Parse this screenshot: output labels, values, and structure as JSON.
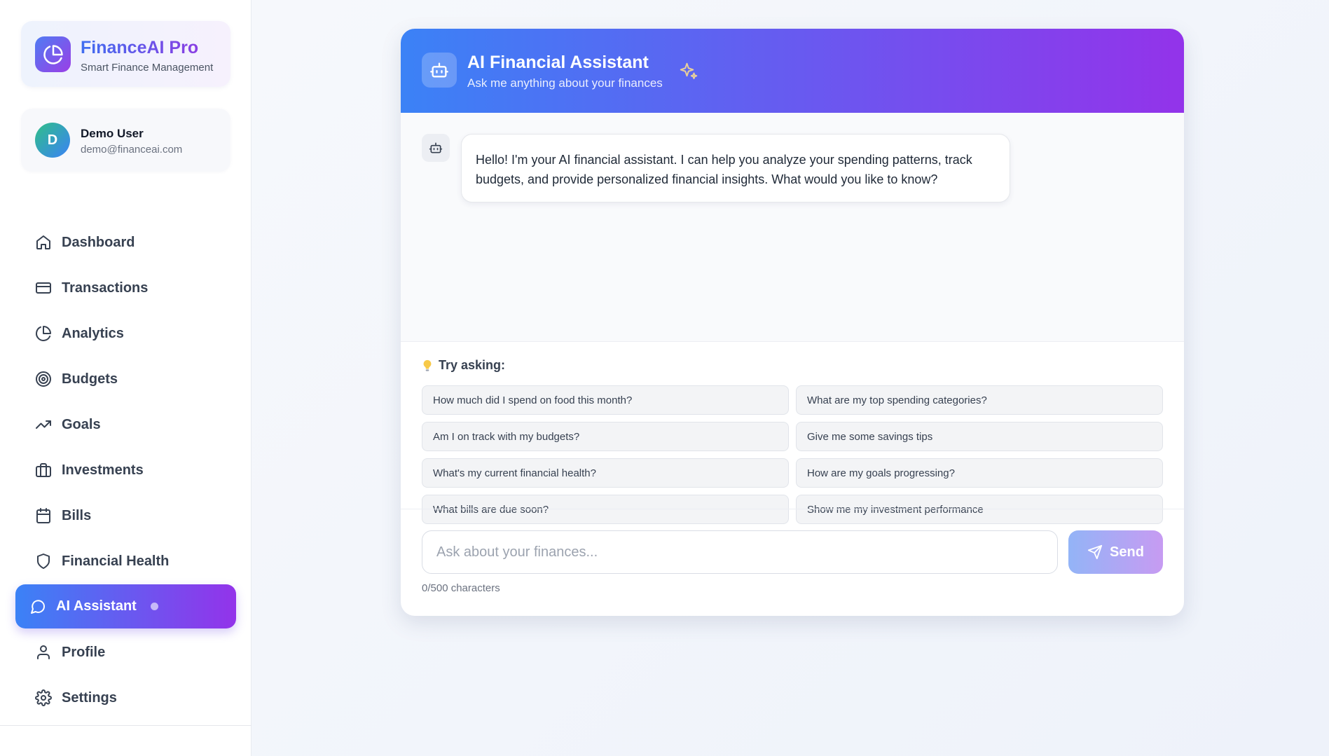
{
  "brand": {
    "name": "FinanceAI Pro",
    "subtitle": "Smart Finance Management"
  },
  "user": {
    "initial": "D",
    "name": "Demo User",
    "email": "demo@financeai.com"
  },
  "nav": {
    "items": [
      {
        "label": "Dashboard",
        "icon": "home-icon"
      },
      {
        "label": "Transactions",
        "icon": "credit-card-icon"
      },
      {
        "label": "Analytics",
        "icon": "pie-chart-icon"
      },
      {
        "label": "Budgets",
        "icon": "target-icon"
      },
      {
        "label": "Goals",
        "icon": "trending-up-icon"
      },
      {
        "label": "Investments",
        "icon": "briefcase-icon"
      },
      {
        "label": "Bills",
        "icon": "calendar-icon"
      },
      {
        "label": "Financial Health",
        "icon": "shield-icon"
      },
      {
        "label": "AI Assistant",
        "icon": "message-circle-icon",
        "active": true
      },
      {
        "label": "Profile",
        "icon": "user-icon"
      },
      {
        "label": "Settings",
        "icon": "gear-icon"
      }
    ]
  },
  "chat": {
    "title": "AI Financial Assistant",
    "subtitle": "Ask me anything about your finances",
    "messages": [
      {
        "sender": "assistant",
        "text": "Hello! I'm your AI financial assistant. I can help you analyze your spending patterns, track budgets, and provide personalized financial insights. What would you like to know?"
      }
    ],
    "suggestions_title": "Try asking:",
    "suggestions": [
      "How much did I spend on food this month?",
      "What are my top spending categories?",
      "Am I on track with my budgets?",
      "Give me some savings tips",
      "What's my current financial health?",
      "How are my goals progressing?",
      "What bills are due soon?",
      "Show me my investment performance"
    ],
    "input_placeholder": "Ask about your finances...",
    "input_value": "",
    "send_label": "Send",
    "char_count": "0/500 characters"
  },
  "colors": {
    "accent_start": "#3b82f6",
    "accent_end": "#9333ea",
    "background": "#f4f6fb"
  }
}
